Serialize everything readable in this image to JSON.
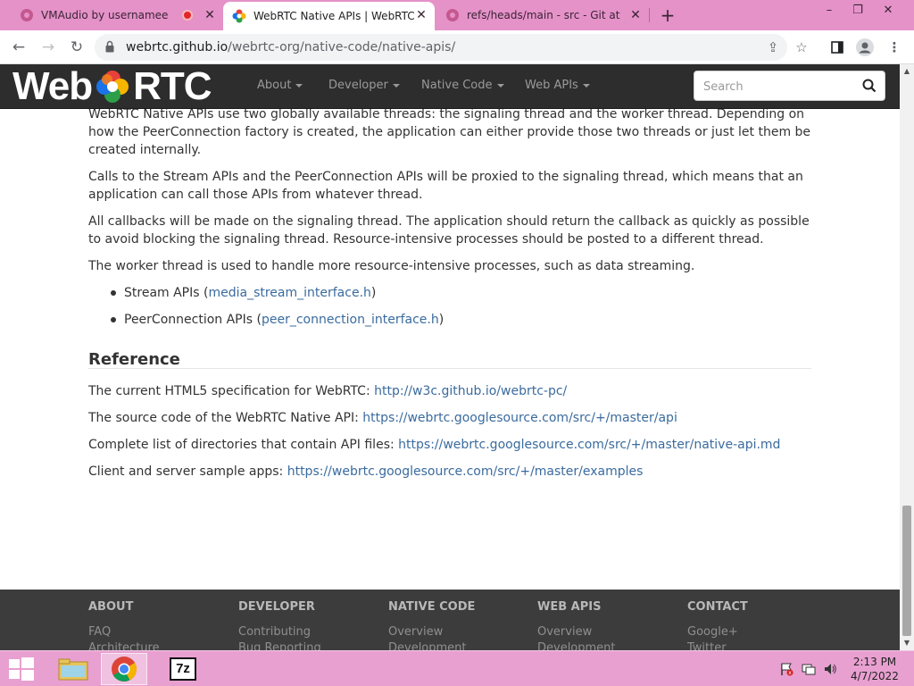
{
  "browser": {
    "tabs": [
      {
        "title": "VMAudio by usernamee",
        "active": false,
        "recording": true
      },
      {
        "title": "WebRTC Native APIs | WebRTC",
        "active": true
      },
      {
        "title": "refs/heads/main - src - Git at Goo",
        "active": false
      }
    ],
    "new_tab": "+",
    "url_host": "webrtc.github.io",
    "url_path": "/webrtc-org/native-code/native-apis/",
    "window_buttons": {
      "minimize": "–",
      "restore": "❐",
      "close": "✕"
    }
  },
  "site": {
    "logo_left": "Web",
    "logo_right": "RTC",
    "nav": [
      "About",
      "Developer",
      "Native Code",
      "Web APIs"
    ],
    "search_placeholder": "Search"
  },
  "content": {
    "paragraphs": [
      "WebRTC Native APIs use two globally available threads: the signaling thread and the worker thread. Depending on how the PeerConnection factory is created, the application can either provide those two threads or just let them be created internally.",
      "Calls to the Stream APIs and the PeerConnection APIs will be proxied to the signaling thread, which means that an application can call those APIs from whatever thread.",
      "All callbacks will be made on the signaling thread. The application should return the callback as quickly as possible to avoid blocking the signaling thread. Resource-intensive processes should be posted to a different thread.",
      "The worker thread is used to handle more resource-intensive processes, such as data streaming."
    ],
    "bullets": [
      {
        "prefix": "Stream APIs (",
        "link": "media_stream_interface.h",
        "suffix": ")"
      },
      {
        "prefix": "PeerConnection APIs (",
        "link": "peer_connection_interface.h",
        "suffix": ")"
      }
    ],
    "reference_heading": "Reference",
    "references": [
      {
        "text": "The current HTML5 specification for WebRTC: ",
        "link": "http://w3c.github.io/webrtc-pc/"
      },
      {
        "text": "The source code of the WebRTC Native API: ",
        "link": "https://webrtc.googlesource.com/src/+/master/api"
      },
      {
        "text": "Complete list of directories that contain API files: ",
        "link": "https://webrtc.googlesource.com/src/+/master/native-api.md"
      },
      {
        "text": "Client and server sample apps: ",
        "link": "https://webrtc.googlesource.com/src/+/master/examples"
      }
    ]
  },
  "footer": {
    "columns": [
      {
        "heading": "ABOUT",
        "links": [
          "FAQ",
          "Architecture"
        ]
      },
      {
        "heading": "DEVELOPER",
        "links": [
          "Contributing",
          "Bug Reporting"
        ]
      },
      {
        "heading": "NATIVE CODE",
        "links": [
          "Overview",
          "Development"
        ]
      },
      {
        "heading": "WEB APIS",
        "links": [
          "Overview",
          "Development"
        ]
      },
      {
        "heading": "CONTACT",
        "links": [
          "Google+",
          "Twitter"
        ]
      }
    ]
  },
  "taskbar": {
    "time": "2:13 PM",
    "date": "4/7/2022",
    "zip_label": "7z"
  },
  "colors": {
    "tabstrip": "#e592c9",
    "navbar": "#2d2d2d",
    "link": "#3a6b9e",
    "footer": "#3c3c3c",
    "taskbar": "#e8a0d0"
  }
}
